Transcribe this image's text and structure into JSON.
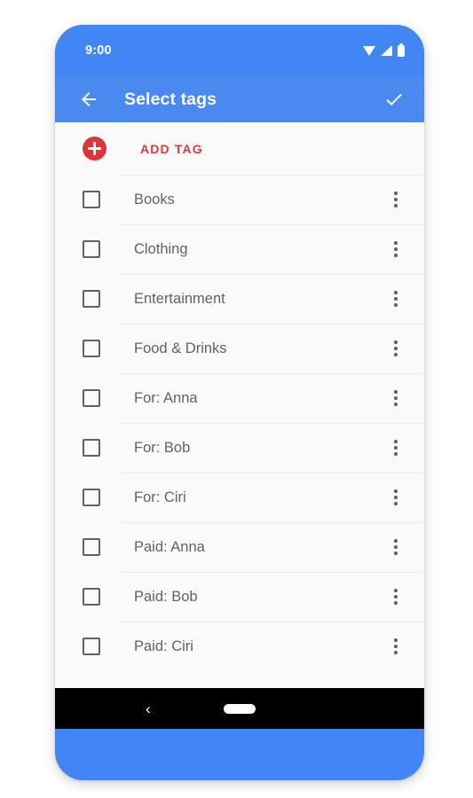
{
  "status_bar": {
    "time": "9:00",
    "icons": [
      "wifi-icon",
      "signal-icon",
      "battery-icon"
    ]
  },
  "app_bar": {
    "back_icon": "back-arrow-icon",
    "title": "Select tags",
    "confirm_icon": "check-icon"
  },
  "add_tag": {
    "icon": "add-circle-icon",
    "label": "ADD TAG",
    "accent_color": "#d93a3f"
  },
  "tags": [
    {
      "label": "Books",
      "checked": false
    },
    {
      "label": "Clothing",
      "checked": false
    },
    {
      "label": "Entertainment",
      "checked": false
    },
    {
      "label": "Food & Drinks",
      "checked": false
    },
    {
      "label": "For: Anna",
      "checked": false
    },
    {
      "label": "For: Bob",
      "checked": false
    },
    {
      "label": "For: Ciri",
      "checked": false
    },
    {
      "label": "Paid: Anna",
      "checked": false
    },
    {
      "label": "Paid: Bob",
      "checked": false
    },
    {
      "label": "Paid: Ciri",
      "checked": false
    }
  ],
  "nav_bar": {
    "back_label": "‹",
    "home_indicator": "home-pill"
  },
  "theme": {
    "frame_blue": "#4285f4",
    "app_bar_blue": "#4a89f0",
    "surface": "#fafafa",
    "text_secondary": "#5f6368",
    "divider": "#ececec"
  }
}
